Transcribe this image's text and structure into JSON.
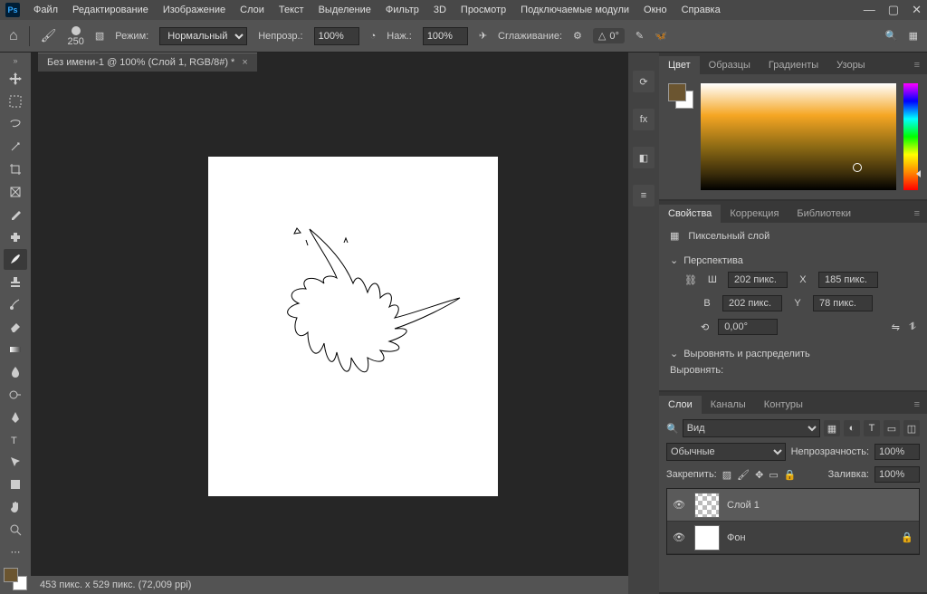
{
  "menu": [
    "Файл",
    "Редактирование",
    "Изображение",
    "Слои",
    "Текст",
    "Выделение",
    "Фильтр",
    "3D",
    "Просмотр",
    "Подключаемые модули",
    "Окно",
    "Справка"
  ],
  "optbar": {
    "brush_size": "250",
    "mode_label": "Режим:",
    "mode_value": "Нормальный",
    "opacity_label": "Непрозр.:",
    "opacity_value": "100%",
    "flow_label": "Наж.:",
    "flow_value": "100%",
    "smoothing_label": "Сглаживание:",
    "angle_value": "0°"
  },
  "document": {
    "tab_title": "Без имени-1 @ 100% (Слой 1, RGB/8#) *",
    "status": "453 пикс. x 529 пикс. (72,009 ppi)"
  },
  "panels": {
    "color_tabs": [
      "Цвет",
      "Образцы",
      "Градиенты",
      "Узоры"
    ],
    "props_tabs": [
      "Свойства",
      "Коррекция",
      "Библиотеки"
    ],
    "layers_tabs": [
      "Слои",
      "Каналы",
      "Контуры"
    ]
  },
  "properties": {
    "layer_type": "Пиксельный слой",
    "transform_header": "Перспектива",
    "W": "202 пикс.",
    "H": "202 пикс.",
    "X": "185 пикс.",
    "Y": "78 пикс.",
    "angle": "0,00°",
    "align_header": "Выровнять и распределить",
    "align_label": "Выровнять:",
    "W_label": "Ш",
    "H_label": "В",
    "X_label": "X",
    "Y_label": "Y"
  },
  "layers": {
    "filter_label": "Вид",
    "blend_mode": "Обычные",
    "opacity_label": "Непрозрачность:",
    "opacity_value": "100%",
    "lock_label": "Закрепить:",
    "fill_label": "Заливка:",
    "fill_value": "100%",
    "items": [
      {
        "name": "Слой 1",
        "selected": true,
        "locked": false,
        "checker": true
      },
      {
        "name": "Фон",
        "selected": false,
        "locked": true,
        "checker": false
      }
    ]
  },
  "colors": {
    "fg": "#6b5530",
    "bg": "#ffffff"
  }
}
